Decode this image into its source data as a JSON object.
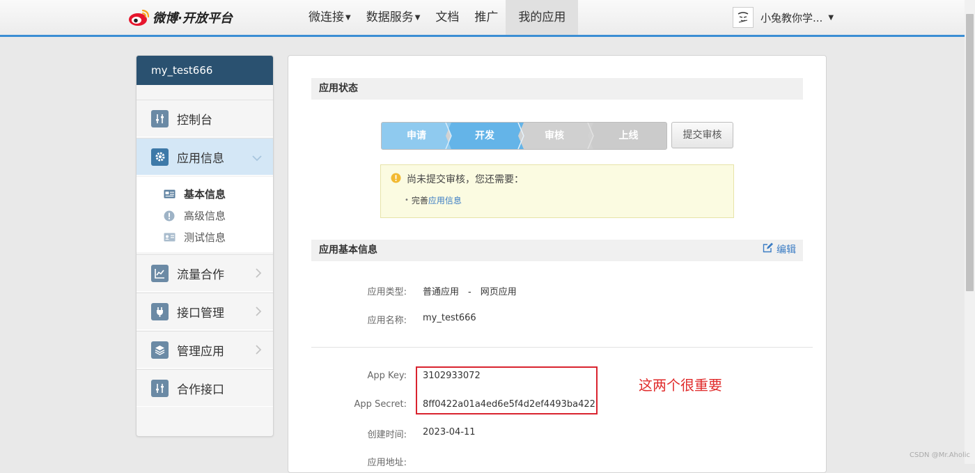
{
  "header": {
    "brand": "微博·开放平台",
    "nav": [
      {
        "label": "微连接",
        "dropdown": true
      },
      {
        "label": "数据服务",
        "dropdown": true
      },
      {
        "label": "文档",
        "dropdown": false
      },
      {
        "label": "推广",
        "dropdown": false
      },
      {
        "label": "我的应用",
        "dropdown": false,
        "active": true
      }
    ],
    "user_name": "小兔教你学..."
  },
  "sidebar": {
    "app_name": "my_test666",
    "items": [
      {
        "label": "控制台",
        "icon": "sliders-icon"
      },
      {
        "label": "应用信息",
        "icon": "gear-icon",
        "expanded": true
      },
      {
        "label": "流量合作",
        "icon": "chart-icon"
      },
      {
        "label": "接口管理",
        "icon": "plug-icon"
      },
      {
        "label": "管理应用",
        "icon": "layers-icon"
      },
      {
        "label": "合作接口",
        "icon": "sliders-icon"
      }
    ],
    "submenu": [
      {
        "label": "基本信息",
        "icon": "id-card-icon",
        "current": true
      },
      {
        "label": "高级信息",
        "icon": "info-circle-icon"
      },
      {
        "label": "测试信息",
        "icon": "test-card-icon"
      }
    ]
  },
  "status_section": {
    "title": "应用状态",
    "steps": [
      {
        "label": "申请",
        "state": "done"
      },
      {
        "label": "开发",
        "state": "current"
      },
      {
        "label": "审核",
        "state": "pending"
      },
      {
        "label": "上线",
        "state": "pending"
      }
    ],
    "submit_label": "提交审核",
    "notice_title": "尚未提交审核，您还需要：",
    "notice_item_prefix": "完善",
    "notice_item_link": "应用信息"
  },
  "basic_info": {
    "title": "应用基本信息",
    "edit_label": "编辑",
    "app_type_label": "应用类型:",
    "app_type_value": "普通应用　-　网页应用",
    "app_name_label": "应用名称:",
    "app_name_value": "my_test666",
    "app_key_label": "App Key:",
    "app_key_value": "3102933072",
    "app_secret_label": "App Secret:",
    "app_secret_value": "8ff0422a01a4ed6e5f4d2ef4493ba422",
    "created_label": "创建时间:",
    "created_value": "2023-04-11",
    "address_label": "应用地址:"
  },
  "annotation": "这两个很重要",
  "watermark": "CSDN @Mr.Aholic",
  "colors": {
    "nav_accent": "#3b8ed4",
    "sidebar_title_bg": "#2a5170",
    "step_done": "#8ec9ee",
    "step_current": "#63b3e8",
    "step_pending": "#c8c8c8",
    "link": "#3b7cc4",
    "annotation_red": "#e02b2b"
  }
}
